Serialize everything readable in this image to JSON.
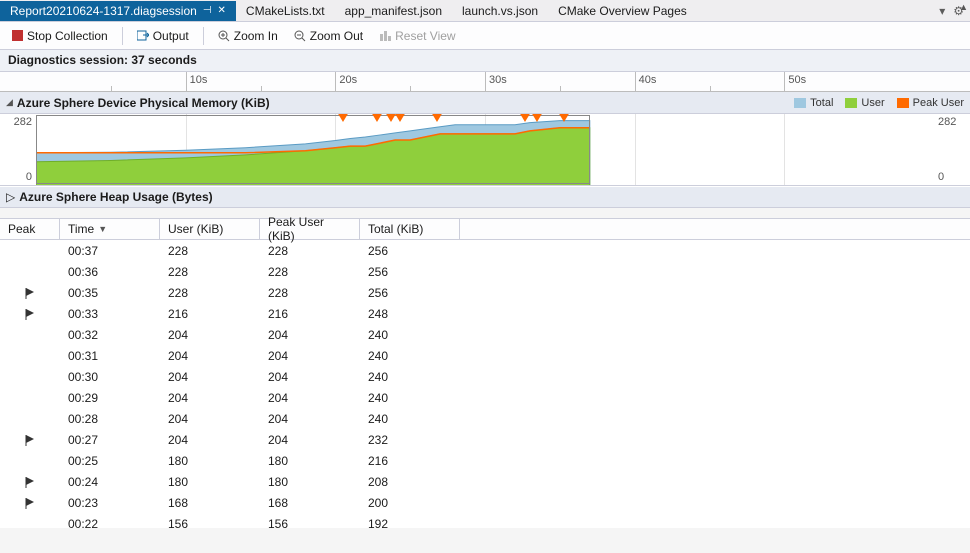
{
  "tabs": {
    "active": "Report20210624-1317.diagsession",
    "others": [
      "CMakeLists.txt",
      "app_manifest.json",
      "launch.vs.json",
      "CMake Overview Pages"
    ]
  },
  "toolbar": {
    "stop": "Stop Collection",
    "output": "Output",
    "zoom_in": "Zoom In",
    "zoom_out": "Zoom Out",
    "reset": "Reset View"
  },
  "session": {
    "label": "Diagnostics session: 37 seconds"
  },
  "timeline": {
    "ticks": [
      "10s",
      "20s",
      "30s",
      "40s",
      "50s"
    ]
  },
  "section1": {
    "title": "Azure Sphere Device Physical Memory (KiB)",
    "legend": {
      "total": "Total",
      "user": "User",
      "peak": "Peak User"
    },
    "ymax": "282",
    "ymin": "0"
  },
  "section2": {
    "title": "Azure Sphere Heap Usage (Bytes)"
  },
  "columns": {
    "peak": "Peak",
    "time": "Time",
    "user": "User (KiB)",
    "peak_user": "Peak User (KiB)",
    "total": "Total (KiB)"
  },
  "rows": [
    {
      "flag": false,
      "time": "00:37",
      "user": "228",
      "peak": "228",
      "total": "256"
    },
    {
      "flag": false,
      "time": "00:36",
      "user": "228",
      "peak": "228",
      "total": "256"
    },
    {
      "flag": true,
      "time": "00:35",
      "user": "228",
      "peak": "228",
      "total": "256"
    },
    {
      "flag": true,
      "time": "00:33",
      "user": "216",
      "peak": "216",
      "total": "248"
    },
    {
      "flag": false,
      "time": "00:32",
      "user": "204",
      "peak": "204",
      "total": "240"
    },
    {
      "flag": false,
      "time": "00:31",
      "user": "204",
      "peak": "204",
      "total": "240"
    },
    {
      "flag": false,
      "time": "00:30",
      "user": "204",
      "peak": "204",
      "total": "240"
    },
    {
      "flag": false,
      "time": "00:29",
      "user": "204",
      "peak": "204",
      "total": "240"
    },
    {
      "flag": false,
      "time": "00:28",
      "user": "204",
      "peak": "204",
      "total": "240"
    },
    {
      "flag": true,
      "time": "00:27",
      "user": "204",
      "peak": "204",
      "total": "232"
    },
    {
      "flag": false,
      "time": "00:25",
      "user": "180",
      "peak": "180",
      "total": "216"
    },
    {
      "flag": true,
      "time": "00:24",
      "user": "180",
      "peak": "180",
      "total": "208"
    },
    {
      "flag": true,
      "time": "00:23",
      "user": "168",
      "peak": "168",
      "total": "200"
    },
    {
      "flag": false,
      "time": "00:22",
      "user": "156",
      "peak": "156",
      "total": "192"
    }
  ],
  "colors": {
    "total": "#9fc8e0",
    "user": "#8fcf3c",
    "peak": "#ff6a00"
  },
  "chart_data": {
    "type": "area",
    "xlabel": "seconds",
    "ylabel": "KiB",
    "ylim": [
      0,
      282
    ],
    "xlim": [
      0,
      60
    ],
    "x": [
      0,
      5,
      10,
      14,
      18,
      20,
      21,
      22,
      23,
      24,
      25,
      27,
      28,
      29,
      30,
      31,
      32,
      33,
      35,
      36,
      37
    ],
    "series": [
      {
        "name": "Total",
        "color": "#9fc8e0",
        "values": [
          130,
          132,
          140,
          150,
          165,
          178,
          186,
          192,
          200,
          208,
          216,
          232,
          240,
          240,
          240,
          240,
          240,
          248,
          256,
          256,
          256
        ]
      },
      {
        "name": "User",
        "color": "#8fcf3c",
        "values": [
          95,
          100,
          110,
          122,
          138,
          150,
          156,
          156,
          168,
          180,
          180,
          204,
          204,
          204,
          204,
          204,
          204,
          216,
          228,
          228,
          228
        ]
      },
      {
        "name": "Peak User",
        "color": "#ff6a00",
        "values": [
          130,
          130,
          130,
          130,
          138,
          150,
          156,
          156,
          168,
          180,
          180,
          204,
          204,
          204,
          204,
          204,
          204,
          216,
          228,
          228,
          228
        ]
      }
    ],
    "markers_x": [
      20.5,
      22.8,
      23.7,
      24.3,
      26.8,
      32.7,
      33.5,
      35.3
    ],
    "selection_end_x": 37
  }
}
